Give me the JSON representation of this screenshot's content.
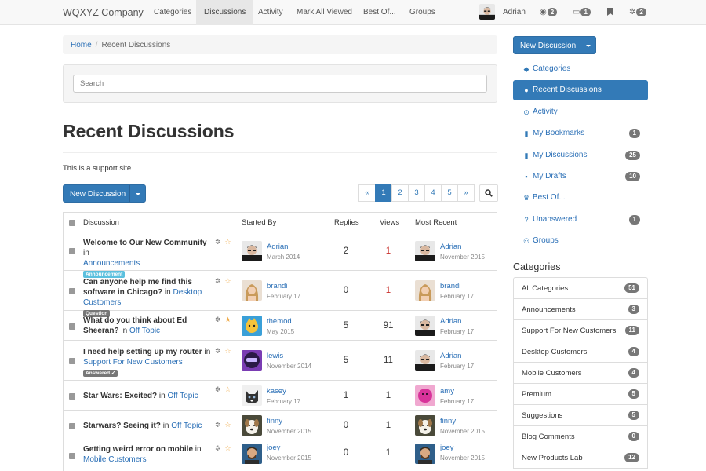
{
  "navbar": {
    "brand": "WQXYZ Company",
    "tabs": [
      {
        "label": "Categories",
        "active": false
      },
      {
        "label": "Discussions",
        "active": true
      },
      {
        "label": "Activity",
        "active": false
      },
      {
        "label": "Mark All Viewed",
        "active": false
      },
      {
        "label": "Best Of...",
        "active": false
      },
      {
        "label": "Groups",
        "active": false
      }
    ],
    "user": "Adrian",
    "notifications_count": "2",
    "inbox_count": "1",
    "settings_count": "2"
  },
  "breadcrumb": {
    "home": "Home",
    "sep": "/",
    "current": "Recent Discussions"
  },
  "search": {
    "placeholder": "Search"
  },
  "page": {
    "title": "Recent Discussions",
    "description": "This is a support site",
    "new_discussion": "New Discussion"
  },
  "pager": {
    "prev": "«",
    "pages": [
      "1",
      "2",
      "3",
      "4",
      "5"
    ],
    "next": "»",
    "current": "1"
  },
  "table": {
    "headers": {
      "discussion": "Discussion",
      "started_by": "Started By",
      "replies": "Replies",
      "views": "Views",
      "most_recent": "Most Recent"
    },
    "rows": [
      {
        "title": "Welcome to Our New Community",
        "in": "in",
        "category": "Announcements",
        "tag": "Announcement",
        "starred": false,
        "started_by": "Adrian",
        "started_date": "March 2014",
        "replies": "2",
        "views": "1",
        "recent_by": "Adrian",
        "recent_date": "November 2015"
      },
      {
        "title": "Can anyone help me find this software in Chicago?",
        "in": "in",
        "category": "Desktop Customers",
        "tag": "Question",
        "starred": false,
        "started_by": "brandi",
        "started_date": "February 17",
        "replies": "0",
        "views": "1",
        "recent_by": "brandi",
        "recent_date": "February 17"
      },
      {
        "title": "What do you think about Ed Sheeran?",
        "in": "in",
        "category": "Off Topic",
        "tag": "",
        "starred": true,
        "started_by": "themod",
        "started_date": "May 2015",
        "replies": "5",
        "views": "91",
        "recent_by": "Adrian",
        "recent_date": "February 17"
      },
      {
        "title": "I need help setting up my router",
        "in": "in",
        "category": "Support For New Customers",
        "tag": "Answered ✓",
        "starred": false,
        "started_by": "lewis",
        "started_date": "November 2014",
        "replies": "5",
        "views": "11",
        "recent_by": "Adrian",
        "recent_date": "February 17"
      },
      {
        "title": "Star Wars: Excited?",
        "in": "in",
        "category": "Off Topic",
        "tag": "",
        "starred": false,
        "started_by": "kasey",
        "started_date": "February 17",
        "replies": "1",
        "views": "1",
        "recent_by": "amy",
        "recent_date": "February 17"
      },
      {
        "title": "Starwars? Seeing it?",
        "in": "in",
        "category": "Off Topic",
        "tag": "",
        "starred": false,
        "started_by": "finny",
        "started_date": "November 2015",
        "replies": "0",
        "views": "1",
        "recent_by": "finny",
        "recent_date": "November 2015"
      },
      {
        "title": "Getting weird error on mobile",
        "in": "in",
        "category": "Mobile Customers",
        "tag": "",
        "starred": false,
        "started_by": "joey",
        "started_date": "November 2015",
        "replies": "0",
        "views": "1",
        "recent_by": "joey",
        "recent_date": "November 2015"
      }
    ]
  },
  "sidebar": {
    "new_discussion": "New Discussion",
    "items": [
      {
        "label": "Categories",
        "icon": "tags-icon",
        "badge": ""
      },
      {
        "label": "Recent Discussions",
        "icon": "comments-icon",
        "badge": ""
      },
      {
        "label": "Activity",
        "icon": "clock-icon",
        "badge": ""
      },
      {
        "label": "My Bookmarks",
        "icon": "bookmark-icon",
        "badge": "1"
      },
      {
        "label": "My Discussions",
        "icon": "bookmark-icon",
        "badge": "25"
      },
      {
        "label": "My Drafts",
        "icon": "document-icon",
        "badge": "10"
      },
      {
        "label": "Best Of...",
        "icon": "trophy-icon",
        "badge": ""
      },
      {
        "label": "Unanswered",
        "icon": "question-icon",
        "badge": "1"
      },
      {
        "label": "Groups",
        "icon": "users-icon",
        "badge": ""
      }
    ],
    "active_item": "Recent Discussions",
    "categories_heading": "Categories",
    "categories": [
      {
        "label": "All Categories",
        "count": "51"
      },
      {
        "label": "Announcements",
        "count": "3"
      },
      {
        "label": "Support For New Customers",
        "count": "11"
      },
      {
        "label": "Desktop Customers",
        "count": "4"
      },
      {
        "label": "Mobile Customers",
        "count": "4"
      },
      {
        "label": "Premium",
        "count": "5"
      },
      {
        "label": "Suggestions",
        "count": "5"
      },
      {
        "label": "Blog Comments",
        "count": "0"
      },
      {
        "label": "New Products Lab",
        "count": "12"
      }
    ]
  },
  "colors": {
    "primary": "#337ab7",
    "link": "#2a6fb6",
    "badge": "#777777",
    "star": "#f0ad4e",
    "views_red": "#c9302c"
  }
}
